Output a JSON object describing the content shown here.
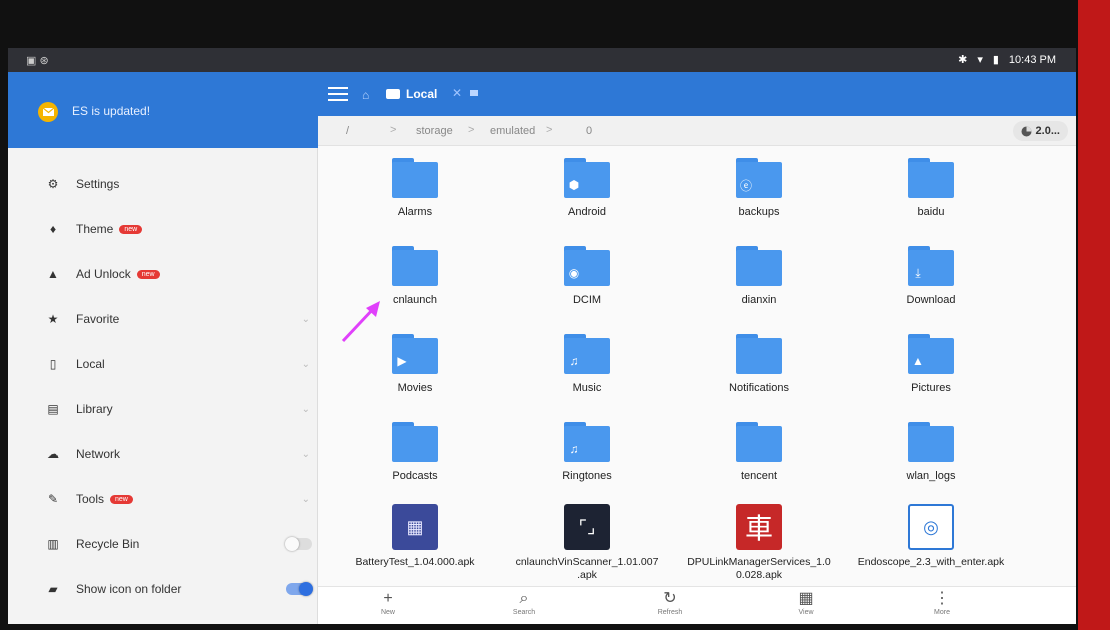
{
  "status": {
    "left_icons": "▣ ⊛",
    "time": "10:43 PM",
    "bluetooth": "✱",
    "wifi": "▾",
    "battery": "▮"
  },
  "drawer": {
    "notice": "ES is updated!",
    "items": [
      {
        "label": "Settings",
        "icon": "gear-icon",
        "glyph": "⚙"
      },
      {
        "label": "Theme",
        "icon": "shirt-icon",
        "glyph": "♦",
        "badge": "new"
      },
      {
        "label": "Ad Unlock",
        "icon": "lock-icon",
        "glyph": "▲",
        "badge": "new"
      },
      {
        "label": "Favorite",
        "icon": "star-icon",
        "glyph": "★",
        "chevron": "⌄"
      },
      {
        "label": "Local",
        "icon": "phone-icon",
        "glyph": "▯",
        "chevron": "⌄"
      },
      {
        "label": "Library",
        "icon": "library-icon",
        "glyph": "▤",
        "chevron": "⌄"
      },
      {
        "label": "Network",
        "icon": "network-icon",
        "glyph": "☁",
        "chevron": "⌄"
      },
      {
        "label": "Tools",
        "icon": "wrench-icon",
        "glyph": "✎",
        "badge": "new",
        "chevron": "⌄"
      },
      {
        "label": "Recycle Bin",
        "icon": "trash-icon",
        "glyph": "▥",
        "toggle": "off"
      },
      {
        "label": "Show icon on folder",
        "icon": "folder-icon",
        "glyph": "▰",
        "toggle": "on"
      }
    ]
  },
  "appbar": {
    "tab_label": "Local",
    "home_glyph": "⌂",
    "close_glyph": "✕"
  },
  "path": {
    "segments": [
      "/",
      "storage",
      "emulated",
      "0"
    ],
    "separator": ">",
    "storage_chip": "2.0..."
  },
  "grid": {
    "folders": [
      {
        "name": "Alarms",
        "glyph": ""
      },
      {
        "name": "Android",
        "glyph": "⬢"
      },
      {
        "name": "backups",
        "glyph": "ⓔ"
      },
      {
        "name": "baidu",
        "glyph": ""
      },
      {
        "name": "cnlaunch",
        "glyph": ""
      },
      {
        "name": "DCIM",
        "glyph": "◉"
      },
      {
        "name": "dianxin",
        "glyph": ""
      },
      {
        "name": "Download",
        "glyph": "⤓"
      },
      {
        "name": "Movies",
        "glyph": "▶"
      },
      {
        "name": "Music",
        "glyph": "♫"
      },
      {
        "name": "Notifications",
        "glyph": ""
      },
      {
        "name": "Pictures",
        "glyph": "▲"
      },
      {
        "name": "Podcasts",
        "glyph": ""
      },
      {
        "name": "Ringtones",
        "glyph": "♫"
      },
      {
        "name": "tencent",
        "glyph": ""
      },
      {
        "name": "wlan_logs",
        "glyph": ""
      }
    ],
    "apks": [
      {
        "line1": "BatteryTest_1.04.000.apk",
        "line2": "",
        "glyph": "▦"
      },
      {
        "line1": "cnlaunchVinScanner_1.01.007",
        "line2": ".apk",
        "glyph": "⌜⌟"
      },
      {
        "line1": "DPULinkManagerServices_1.0",
        "line2": "0.028.apk",
        "glyph": "車"
      },
      {
        "line1": "Endoscope_2.3_with_enter.apk",
        "line2": "",
        "glyph": "◎"
      }
    ]
  },
  "bottombar": [
    {
      "label": "New",
      "glyph": "+"
    },
    {
      "label": "Search",
      "glyph": "⌕"
    },
    {
      "label": "Refresh",
      "glyph": "↻"
    },
    {
      "label": "View",
      "glyph": "▦"
    },
    {
      "label": "More",
      "glyph": "⋮"
    }
  ],
  "colors": {
    "accent": "#2e78d6",
    "folder": "#4a98ee",
    "badge": "#e53935",
    "annotation_arrow": "#e040fb"
  }
}
